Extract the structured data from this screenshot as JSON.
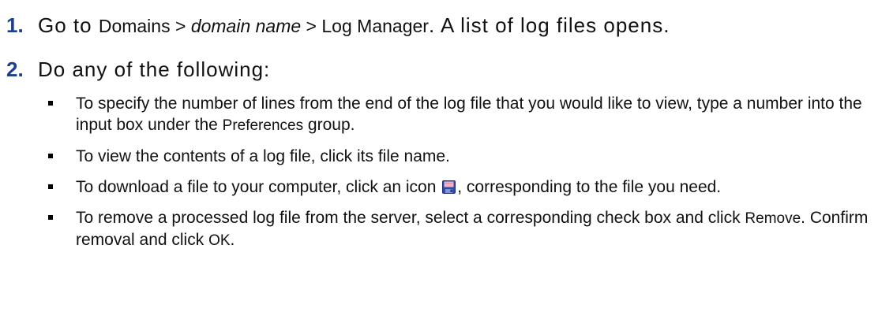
{
  "steps": [
    {
      "number": "1.",
      "prefix": "Go to ",
      "domains": "Domains",
      "sep1": " > ",
      "domain_name": "domain name",
      "sep2": " > ",
      "log_manager": "Log Manager",
      "suffix": ". A list of log files opens."
    },
    {
      "number": "2.",
      "text": "Do any of the following:"
    }
  ],
  "bullets": [
    {
      "before": "To specify the number of lines from the end of the log file that you would like to view, type a number into the input box under the ",
      "ui": "Preferences",
      "after": " group."
    },
    {
      "text": "To view the contents of a log file, click its file name."
    },
    {
      "before": "To download a file to your computer, click an icon ",
      "icon": "floppy-disk-save-icon",
      "after": ", corresponding to the file you need."
    },
    {
      "before": "To remove a processed log file from the server, select a corresponding check box and click ",
      "ui1": "Remove",
      "middle": ". Confirm removal and click ",
      "ui2": "OK",
      "after": "."
    }
  ],
  "colors": {
    "step_number": "#1a3f8f",
    "text": "#111111",
    "icon_body": "#2f4aa8",
    "icon_label": "#f3b3c6"
  }
}
